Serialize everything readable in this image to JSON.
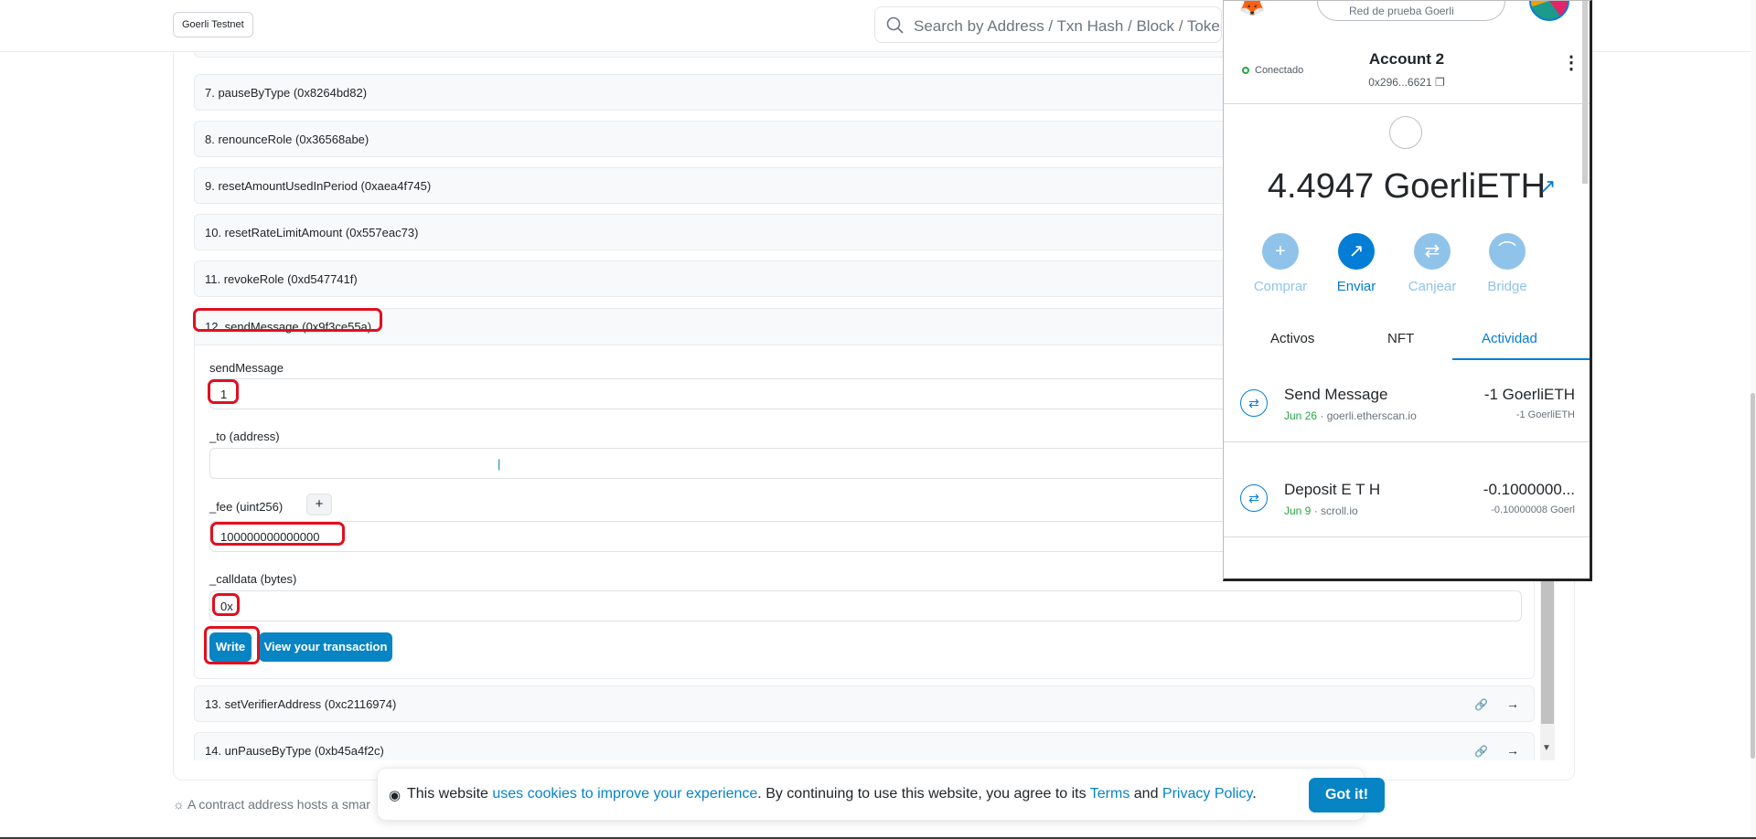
{
  "header": {
    "network_label": "Goerli Testnet",
    "search_placeholder": "Search by Address / Txn Hash / Block / Token"
  },
  "functions": [
    {
      "label": "7. pauseByType (0x8264bd82)"
    },
    {
      "label": "8. renounceRole (0x36568abe)"
    },
    {
      "label": "9. resetAmountUsedInPeriod (0xaea4f745)"
    },
    {
      "label": "10. resetRateLimitAmount (0x557eac73)"
    },
    {
      "label": "11. revokeRole (0xd547741f)"
    }
  ],
  "expanded": {
    "label": "12. sendMessage (0x9f3ce55a)",
    "payable_label": "sendMessage",
    "payable_value": "1",
    "to_label": "_to (address)",
    "to_value": "",
    "fee_label": "_fee (uint256)",
    "fee_add": "+",
    "fee_value": "100000000000000",
    "calldata_label": "_calldata (bytes)",
    "calldata_value": "0x",
    "write_label": "Write",
    "view_tx_label": "View your transaction"
  },
  "functions_after": [
    {
      "label": "13. setVerifierAddress (0xc2116974)"
    },
    {
      "label": "14. unPauseByType (0xb45a4f2c)"
    }
  ],
  "tip_text": "A contract address hosts a smar",
  "cookie": {
    "prefix": "This website ",
    "link1": "uses cookies to improve your experience",
    "middle": ". By continuing to use this website, you agree to its ",
    "terms": "Terms",
    "and": " and ",
    "privacy": "Privacy Policy",
    "suffix": ".",
    "button": "Got it!"
  },
  "metamask": {
    "network": "Red de prueba Goerli",
    "connected": "Conectado",
    "account_name": "Account 2",
    "account_address": "0x296...6621",
    "balance": "4.4947 GoerliETH",
    "actions": [
      {
        "label": "Comprar",
        "icon": "+"
      },
      {
        "label": "Enviar",
        "icon": "↗"
      },
      {
        "label": "Canjear",
        "icon": "⇄"
      },
      {
        "label": "Bridge",
        "icon": "⌒"
      }
    ],
    "tabs": [
      "Activos",
      "NFT",
      "Actividad"
    ],
    "transactions": [
      {
        "title": "Send Message",
        "date": "Jun 26",
        "origin": " · goerli.etherscan.io",
        "amount": "-1 GoerliETH",
        "amount2": "-1 GoerliETH"
      },
      {
        "title": "Deposit E T H",
        "date": "Jun 9",
        "origin": " · scroll.io",
        "amount": "-0.1000000...",
        "amount2": "-0.10000008 Goerl"
      }
    ],
    "colors": {
      "accent": "#037dd6",
      "accent_light": "#90c3ea"
    }
  }
}
